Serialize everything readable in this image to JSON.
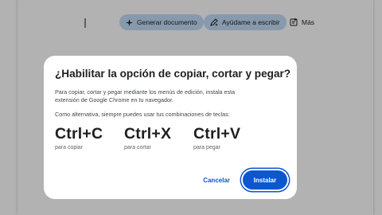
{
  "toolbar": {
    "generate_label": "Generar documento",
    "help_label": "Ayúdame a escribir",
    "more_label": "Más"
  },
  "dialog": {
    "title": "¿Habilitar la opción de copiar, cortar y pegar?",
    "description": "Para copiar, cortar y pegar mediante los menús de edición, instala esta extensión de Google Chrome en tu navegador.",
    "alternative": "Como alternativa, siempre puedes usar tus combinaciones de teclas:",
    "shortcuts": [
      {
        "key": "Ctrl+C",
        "label": "para copiar"
      },
      {
        "key": "Ctrl+X",
        "label": "para cortar"
      },
      {
        "key": "Ctrl+V",
        "label": "para pegar"
      }
    ],
    "cancel_label": "Cancelar",
    "install_label": "Instalar"
  },
  "colors": {
    "accent": "#0b57d0",
    "chip_bg": "#c2dbf6",
    "scrim": "rgba(0,0,0,0.30)"
  },
  "icons": [
    "sparkle-icon",
    "pen-sparkle-icon",
    "document-plus-icon"
  ]
}
